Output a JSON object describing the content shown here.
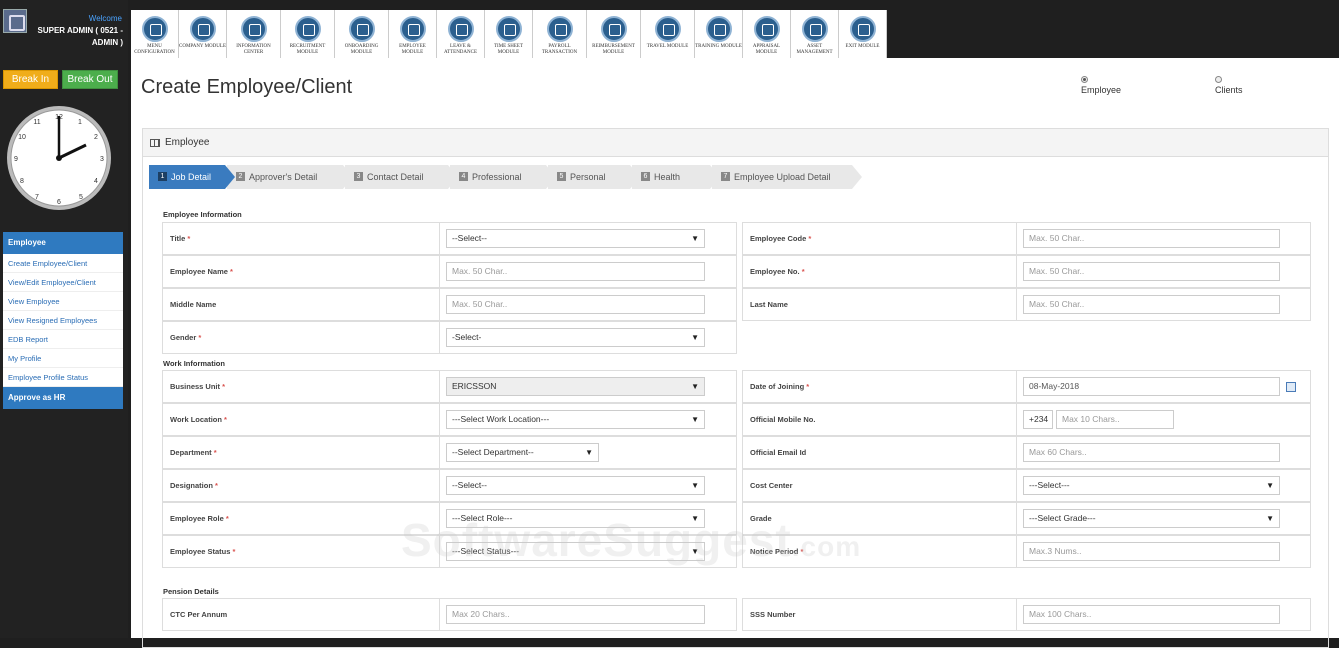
{
  "user": {
    "welcome": "Welcome",
    "name": "SUPER ADMIN ( 0521 - ADMIN )"
  },
  "buttons": {
    "break_in": "Break In",
    "break_out": "Break Out"
  },
  "modules": [
    {
      "label": "MENU CONFIGURATION"
    },
    {
      "label": "COMPANY MODULE"
    },
    {
      "label": "INFORMATION CENTER"
    },
    {
      "label": "RECRUITMENT MODULE"
    },
    {
      "label": "ONBOARDING MODULE"
    },
    {
      "label": "EMPLOYEE MODULE"
    },
    {
      "label": "LEAVE & ATTENDANCE"
    },
    {
      "label": "TIME SHEET MODULE"
    },
    {
      "label": "PAYROLL TRANSACTION"
    },
    {
      "label": "REIMBURSEMENT MODULE"
    },
    {
      "label": "TRAVEL MODULE"
    },
    {
      "label": "TRAINING MODULE"
    },
    {
      "label": "APPRAISAL MODULE"
    },
    {
      "label": "ASSET MANAGEMENT"
    },
    {
      "label": "EXIT MODULE"
    }
  ],
  "sidebar": {
    "header": "Employee",
    "items": [
      "Create Employee/Client",
      "View/Edit Employee/Client",
      "View Employee",
      "View Resigned Employees",
      "EDB Report",
      "My Profile",
      "Employee Profile Status"
    ],
    "footer": "Approve as HR"
  },
  "page": {
    "title": "Create Employee/Client",
    "radio_employee": "Employee",
    "radio_clients": "Clients",
    "panel_title": "Employee"
  },
  "wizard": [
    {
      "num": "1",
      "label": "Job Detail"
    },
    {
      "num": "2",
      "label": "Approver's Detail"
    },
    {
      "num": "3",
      "label": "Contact Detail"
    },
    {
      "num": "4",
      "label": "Professional"
    },
    {
      "num": "5",
      "label": "Personal"
    },
    {
      "num": "6",
      "label": "Health"
    },
    {
      "num": "7",
      "label": "Employee Upload Detail"
    }
  ],
  "sections": {
    "employee_info": "Employee Information",
    "work_info": "Work Information",
    "pension": "Pension Details"
  },
  "form": {
    "title": {
      "label": "Title",
      "value": "--Select--"
    },
    "employee_code": {
      "label": "Employee Code",
      "placeholder": "Max. 50 Char.."
    },
    "employee_name": {
      "label": "Employee Name",
      "placeholder": "Max. 50 Char.."
    },
    "employee_no": {
      "label": "Employee No.",
      "placeholder": "Max. 50 Char.."
    },
    "middle_name": {
      "label": "Middle Name",
      "placeholder": "Max. 50 Char.."
    },
    "last_name": {
      "label": "Last Name",
      "placeholder": "Max. 50 Char.."
    },
    "gender": {
      "label": "Gender",
      "value": "-Select-"
    },
    "business_unit": {
      "label": "Business Unit",
      "value": "ERICSSON"
    },
    "date_of_joining": {
      "label": "Date of Joining",
      "value": "08-May-2018"
    },
    "work_location": {
      "label": "Work Location",
      "value": "---Select Work Location---"
    },
    "official_mobile": {
      "label": "Official Mobile No.",
      "code": "+234",
      "placeholder": "Max 10 Chars.."
    },
    "department": {
      "label": "Department",
      "value": "--Select Department--"
    },
    "official_email": {
      "label": "Official Email Id",
      "placeholder": "Max 60 Chars.."
    },
    "designation": {
      "label": "Designation",
      "value": "--Select--"
    },
    "cost_center": {
      "label": "Cost Center",
      "value": "---Select---"
    },
    "employee_role": {
      "label": "Employee Role",
      "value": "---Select Role---"
    },
    "grade": {
      "label": "Grade",
      "value": "---Select Grade---"
    },
    "employee_status": {
      "label": "Employee Status",
      "value": "---Select Status---"
    },
    "notice_period": {
      "label": "Notice Period",
      "placeholder": "Max.3 Nums.."
    },
    "ctc": {
      "label": "CTC Per Annum",
      "placeholder": "Max 20 Chars.."
    },
    "sss": {
      "label": "SSS Number",
      "placeholder": "Max 100 Chars.."
    }
  },
  "watermark": {
    "main": "SoftwareSuggest",
    "suffix": ".com"
  }
}
